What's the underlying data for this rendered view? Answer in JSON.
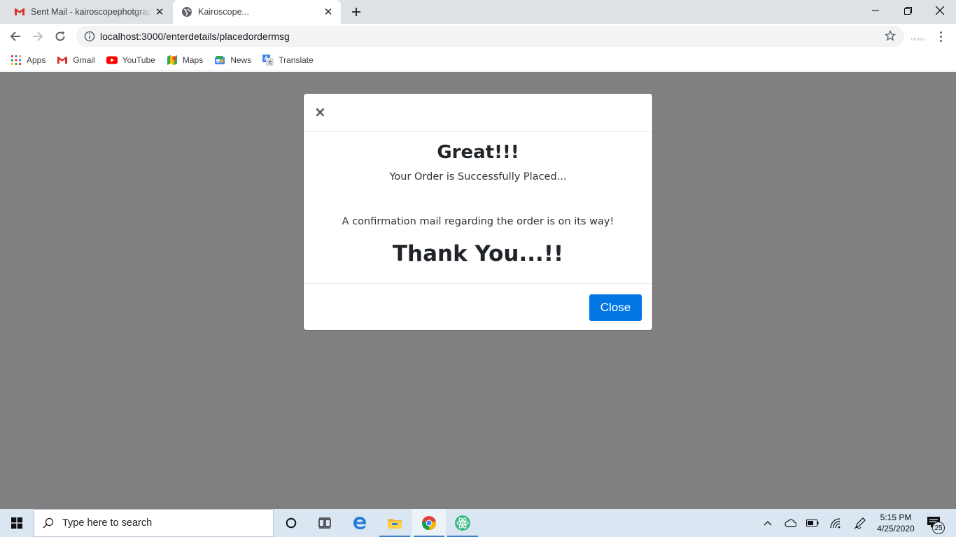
{
  "browser": {
    "tabs": [
      {
        "title": "Sent Mail - kairoscopephotgraph",
        "favicon": "gmail-icon"
      },
      {
        "title": "Kairoscope...",
        "favicon": "globe-icon"
      }
    ],
    "url": "localhost:3000/enterdetails/placedordermsg",
    "bookmarks": [
      {
        "label": "Apps",
        "icon": "apps-grid-icon"
      },
      {
        "label": "Gmail",
        "icon": "gmail-icon"
      },
      {
        "label": "YouTube",
        "icon": "youtube-icon"
      },
      {
        "label": "Maps",
        "icon": "maps-icon"
      },
      {
        "label": "News",
        "icon": "news-icon"
      },
      {
        "label": "Translate",
        "icon": "translate-icon"
      }
    ]
  },
  "modal": {
    "close_symbol": "×",
    "heading": "Great!!!",
    "subheading": "Your Order is Successfully Placed...",
    "message": "A confirmation mail regarding the order is on its way!",
    "thanks": "Thank You...!!",
    "close_button": "Close"
  },
  "taskbar": {
    "search_placeholder": "Type here to search",
    "time": "5:15 PM",
    "date": "4/25/2020",
    "notification_count": "25",
    "accent_color": "#0277e4"
  }
}
